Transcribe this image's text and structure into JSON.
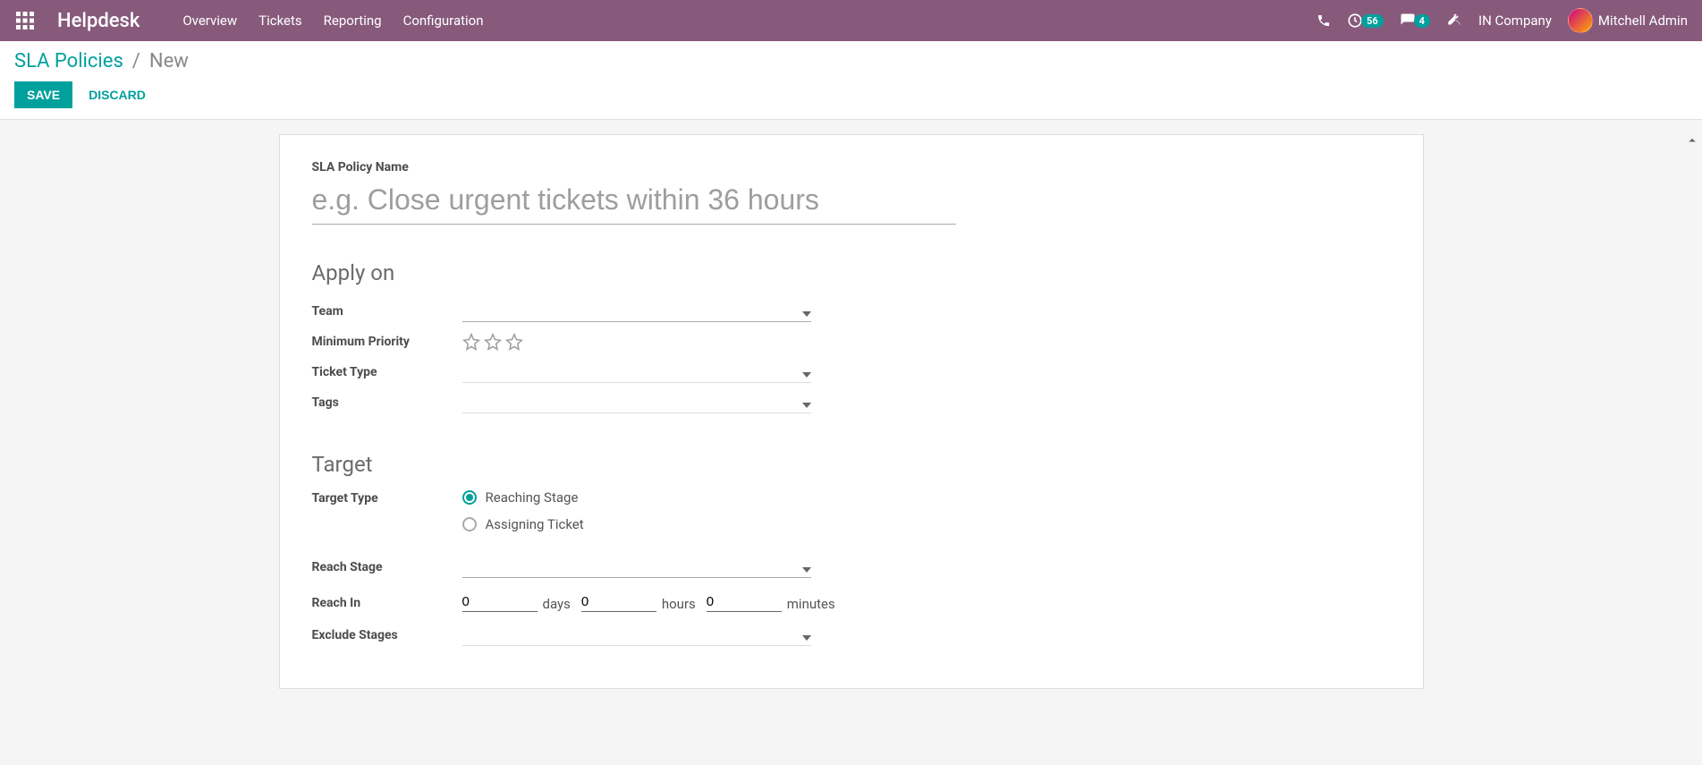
{
  "nav": {
    "app_title": "Helpdesk",
    "menu": [
      "Overview",
      "Tickets",
      "Reporting",
      "Configuration"
    ],
    "badge_clock": "56",
    "badge_chat": "4",
    "company": "IN Company",
    "user": "Mitchell Admin"
  },
  "breadcrumb": {
    "root": "SLA Policies",
    "current": "New"
  },
  "actions": {
    "save": "SAVE",
    "discard": "DISCARD"
  },
  "form": {
    "name_label": "SLA Policy Name",
    "name_placeholder": "e.g. Close urgent tickets within 36 hours",
    "name_value": "",
    "sections": {
      "apply_on": "Apply on",
      "target": "Target"
    },
    "labels": {
      "team": "Team",
      "min_priority": "Minimum Priority",
      "ticket_type": "Ticket Type",
      "tags": "Tags",
      "target_type": "Target Type",
      "reach_stage": "Reach Stage",
      "reach_in": "Reach In",
      "exclude_stages": "Exclude Stages"
    },
    "target_type_options": {
      "reaching": "Reaching Stage",
      "assigning": "Assigning Ticket"
    },
    "reach_in": {
      "days": "0",
      "days_unit": "days",
      "hours": "0",
      "hours_unit": "hours",
      "minutes": "0",
      "minutes_unit": "minutes"
    }
  },
  "colors": {
    "primary": "#00a09d",
    "navbar": "#875a7b"
  }
}
